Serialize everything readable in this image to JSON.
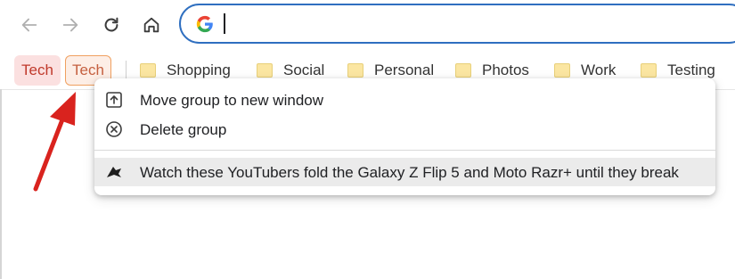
{
  "toolbar": {
    "back_icon": "arrow-left-icon",
    "forward_icon": "arrow-right-icon",
    "reload_icon": "reload-icon",
    "home_icon": "home-icon",
    "omnibox_value": ""
  },
  "bookmarks": {
    "groups": [
      {
        "label": "Tech",
        "color": "#c0392b"
      },
      {
        "label": "Tech",
        "color": "#e08040",
        "selected": true
      }
    ],
    "folders": [
      {
        "label": "Shopping"
      },
      {
        "label": "Social"
      },
      {
        "label": "Personal"
      },
      {
        "label": "Photos"
      },
      {
        "label": "Work"
      },
      {
        "label": "Testing"
      }
    ]
  },
  "context_menu": {
    "items": [
      {
        "label": "Move group to new window",
        "icon": "move-window-icon"
      },
      {
        "label": "Delete group",
        "icon": "delete-circle-icon"
      }
    ],
    "tab_item": {
      "label": "Watch these YouTubers fold the Galaxy Z Flip 5 and Moto Razr+ until they break",
      "icon": "site-favicon-icon"
    }
  },
  "colors": {
    "omnibox_border": "#2f6fc0",
    "annotation_arrow": "#d9231e"
  }
}
